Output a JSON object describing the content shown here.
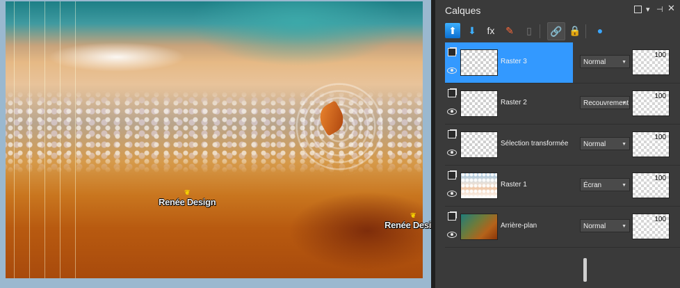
{
  "palette": {
    "title": "Calques",
    "controls": {
      "maximize": "□",
      "menu": "▾",
      "pin": "⊣",
      "close": "✕"
    },
    "toolbar": [
      {
        "name": "new-raster-layer-icon",
        "glyph": "⬆"
      },
      {
        "name": "new-vector-layer-icon",
        "glyph": "⬇"
      },
      {
        "name": "layer-effects-icon",
        "glyph": "fx"
      },
      {
        "name": "adjustment-layer-icon",
        "glyph": "✎"
      },
      {
        "name": "mask-layer-icon",
        "glyph": "▯"
      },
      {
        "name": "link-icon",
        "glyph": "🔗"
      },
      {
        "name": "lock-icon",
        "glyph": "🔒"
      },
      {
        "name": "layer-style-icon",
        "glyph": "●"
      }
    ],
    "layers": [
      {
        "name": "Raster 3",
        "blend": "Normal",
        "opacity": "100",
        "selected": true
      },
      {
        "name": "Raster 2",
        "blend": "Recouvrement",
        "opacity": "100",
        "selected": false
      },
      {
        "name": "Sélection transformée",
        "blend": "Normal",
        "opacity": "100",
        "selected": false
      },
      {
        "name": "Raster 1",
        "blend": "Écran",
        "opacity": "100",
        "selected": false
      },
      {
        "name": "Arrière-plan",
        "blend": "Normal",
        "opacity": "100",
        "selected": false
      }
    ],
    "accent_color": "#3399ff"
  },
  "canvas": {
    "watermarks": [
      "Renée Design",
      "Renée Design"
    ]
  }
}
